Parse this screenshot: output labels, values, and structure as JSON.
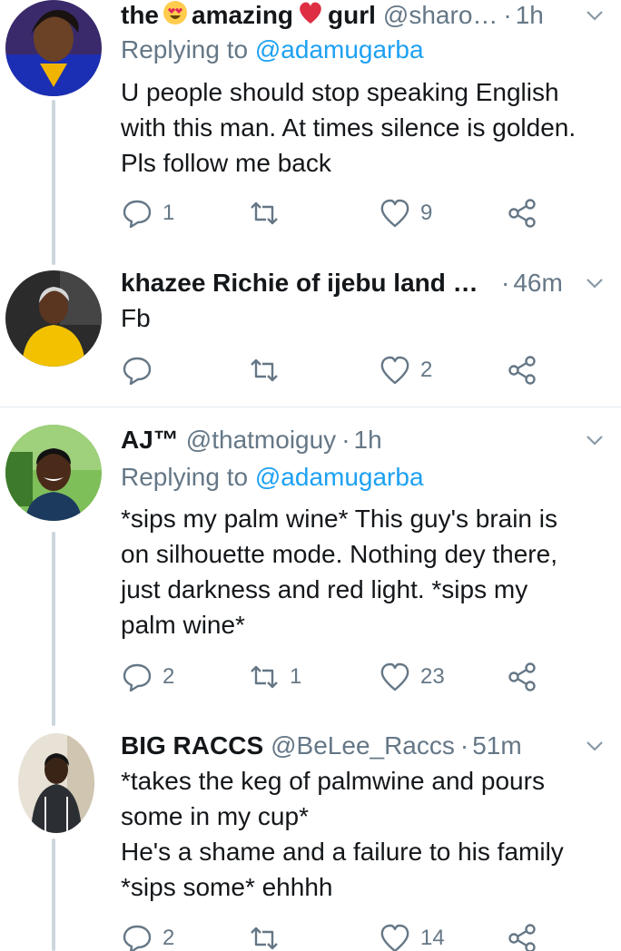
{
  "colors": {
    "text": "#14171a",
    "muted": "#657786",
    "link": "#1da1f2",
    "line": "#ccd6dd",
    "heart": "#e0245e"
  },
  "tweets": [
    {
      "name_prefix": "the",
      "name_middle": "amazing",
      "name_suffix": "gurl",
      "handle": "@sharo…",
      "time": "1h",
      "replying_label": "Replying to",
      "replying_to": "@adamugarba",
      "text_lines": [
        "U people should stop speaking English",
        "with this man. At times silence is golden.",
        "Pls follow me back"
      ],
      "replies": "1",
      "retweets": "",
      "likes": "9"
    },
    {
      "name": "khazee Richie of ijebu land …",
      "time": "46m",
      "text_lines": [
        "Fb"
      ],
      "replies": "",
      "retweets": "",
      "likes": "2"
    },
    {
      "name": "AJ™",
      "handle": "@thatmoiguy",
      "time": "1h",
      "replying_label": "Replying to",
      "replying_to": "@adamugarba",
      "text_lines": [
        "*sips my palm wine* This guy's brain is",
        "on silhouette mode. Nothing dey there,",
        "just darkness and red light. *sips my",
        "palm wine*"
      ],
      "replies": "2",
      "retweets": "1",
      "likes": "23"
    },
    {
      "name": "BIG RACCS",
      "handle": "@BeLee_Raccs",
      "time": "51m",
      "text_lines": [
        "*takes the keg of palmwine and pours",
        "some in my cup*",
        "He's a shame and a failure to his family",
        "*sips some* ehhhh"
      ],
      "replies": "2",
      "retweets": "",
      "likes": "14"
    }
  ]
}
